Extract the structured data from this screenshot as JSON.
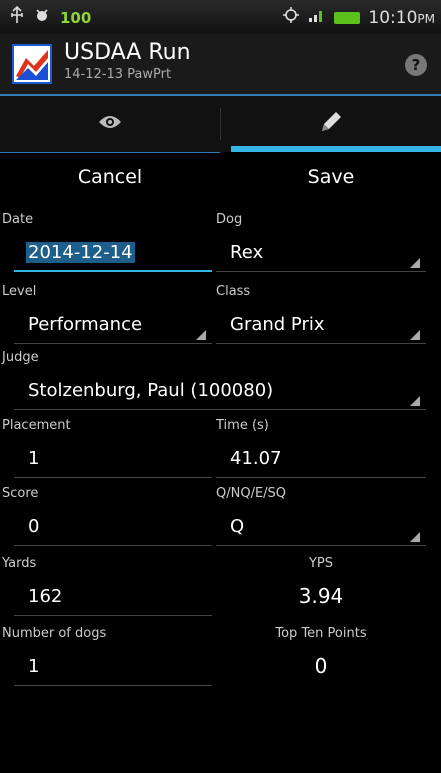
{
  "status_bar": {
    "battery_level_text": "100",
    "time": "10:10",
    "time_suffix": "PM"
  },
  "action_bar": {
    "title": "USDAA Run",
    "subtitle": "14-12-13 PawPrt",
    "help_label": "?"
  },
  "tabs": {
    "view_icon": "eye-icon",
    "edit_icon": "pencil-icon",
    "selected": "edit"
  },
  "buttons": {
    "cancel": "Cancel",
    "save": "Save"
  },
  "form": {
    "date": {
      "label": "Date",
      "value": "2014-12-14"
    },
    "dog": {
      "label": "Dog",
      "value": "Rex"
    },
    "level": {
      "label": "Level",
      "value": "Performance"
    },
    "class": {
      "label": "Class",
      "value": "Grand Prix"
    },
    "judge": {
      "label": "Judge",
      "value": "Stolzenburg, Paul (100080)"
    },
    "placement": {
      "label": "Placement",
      "value": "1"
    },
    "time": {
      "label": "Time (s)",
      "value": "41.07"
    },
    "score": {
      "label": "Score",
      "value": "0"
    },
    "qualifier": {
      "label": "Q/NQ/E/SQ",
      "value": "Q"
    },
    "yards": {
      "label": "Yards",
      "value": "162"
    },
    "yps": {
      "label": "YPS",
      "value": "3.94"
    },
    "number_of_dogs": {
      "label": "Number of dogs",
      "value": "1"
    },
    "top_ten_points": {
      "label": "Top Ten Points",
      "value": "0"
    }
  },
  "colors": {
    "accent": "#33b5e5",
    "battery": "#5cc21b",
    "background": "#000000"
  }
}
